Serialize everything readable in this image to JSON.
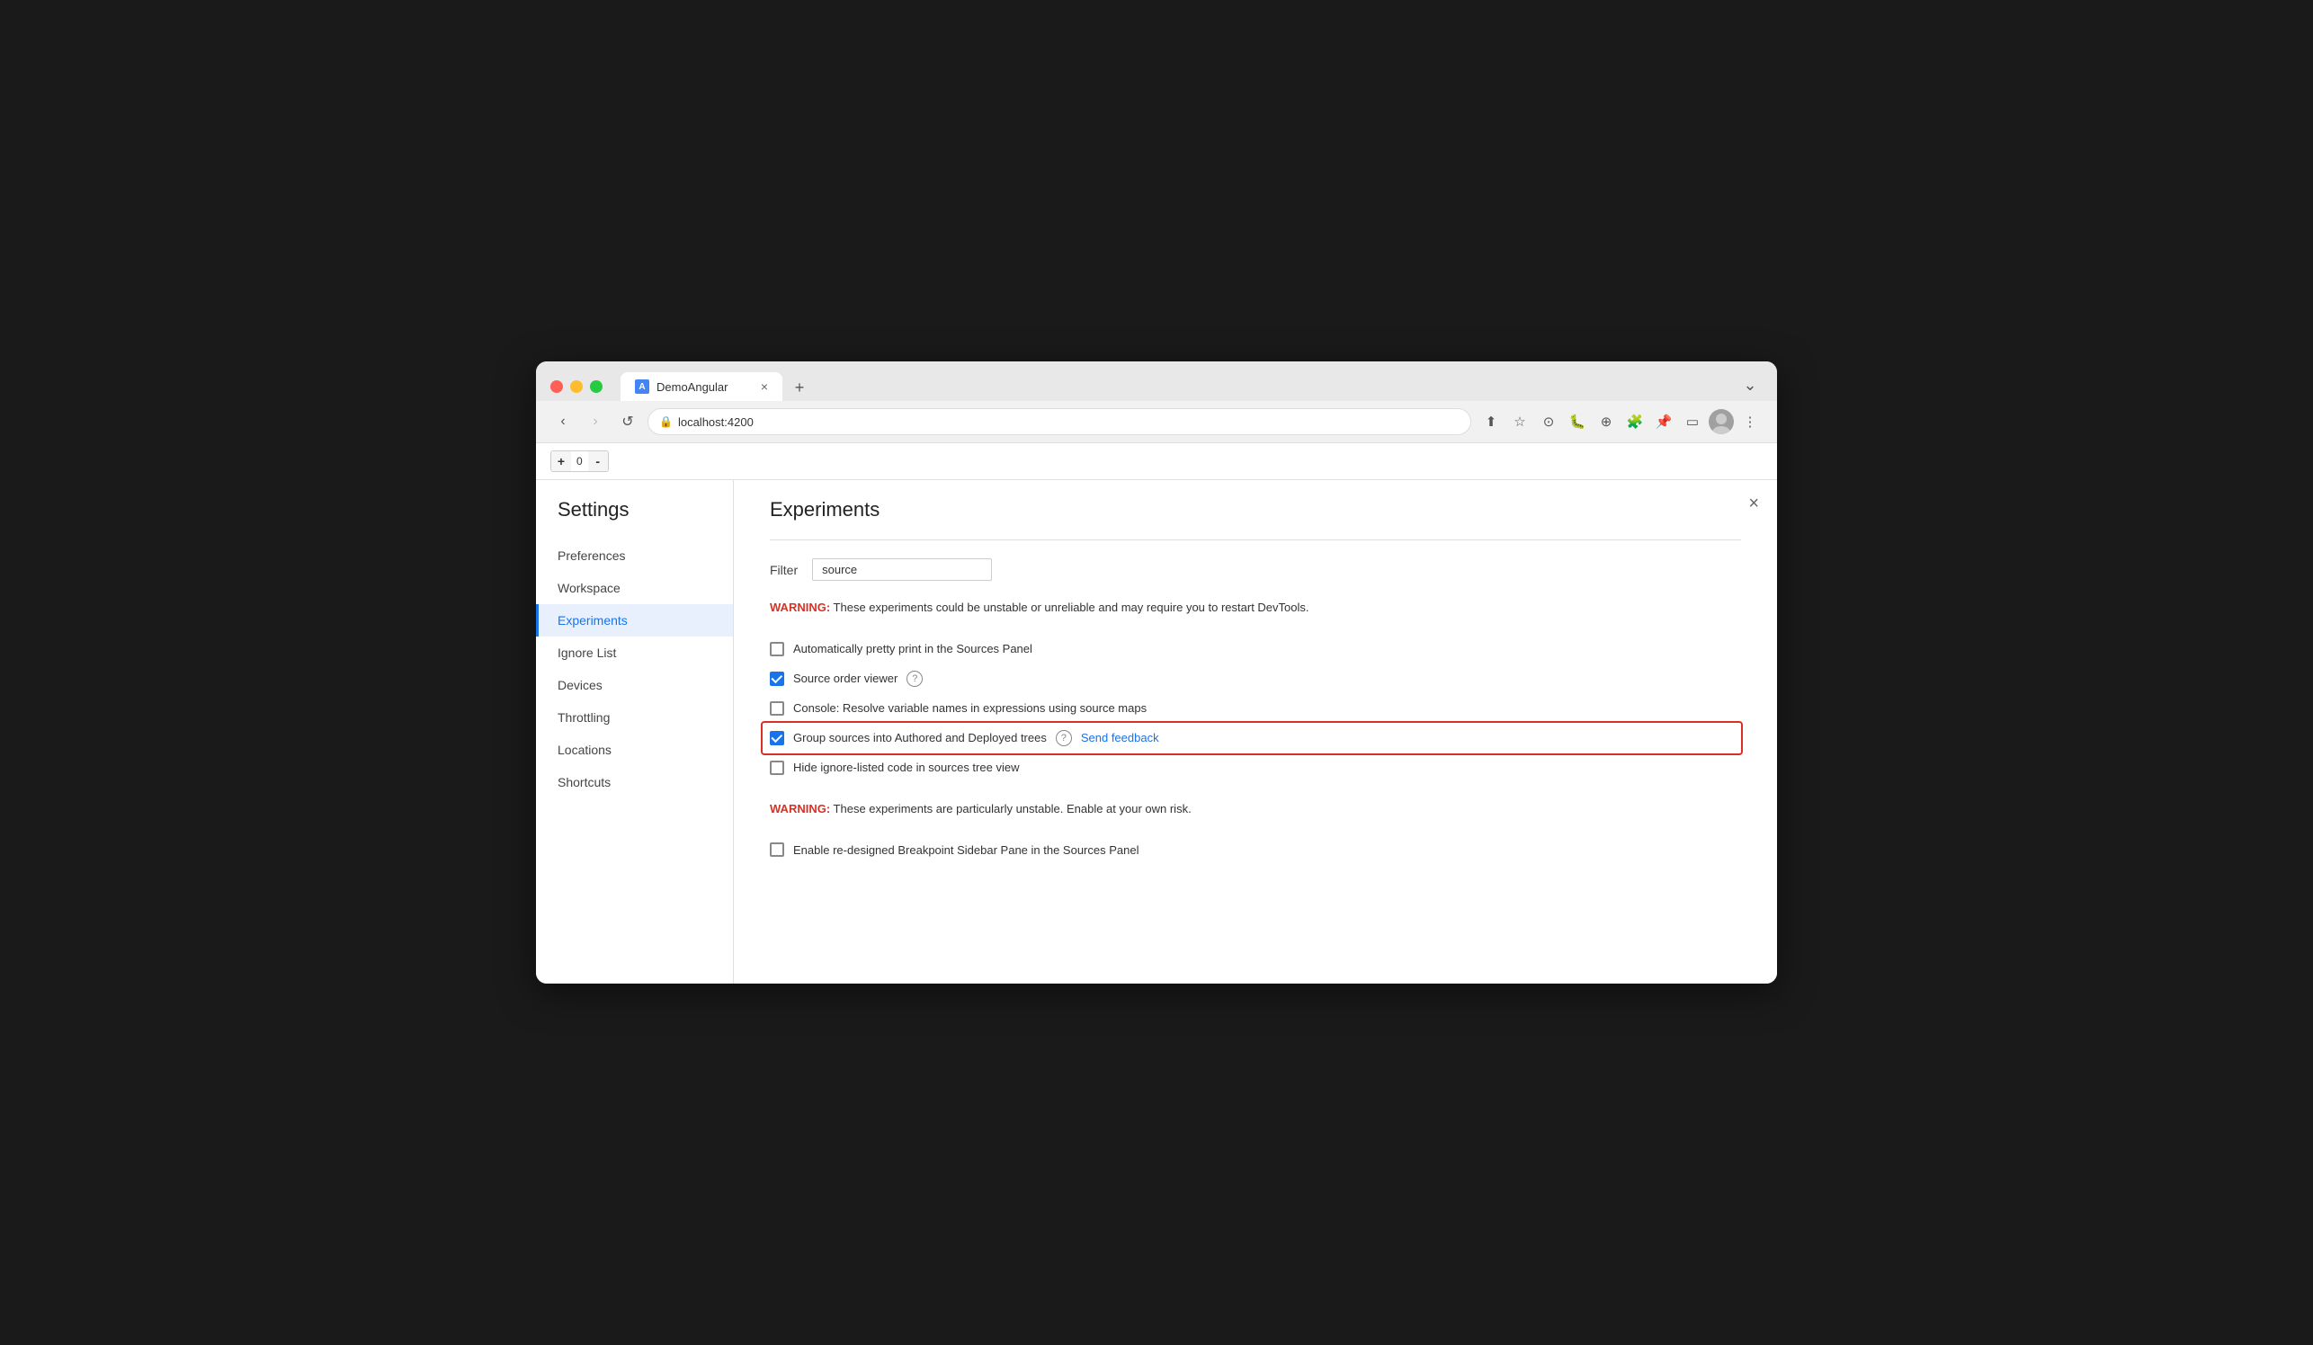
{
  "browser": {
    "tab_title": "DemoAngular",
    "tab_favicon": "A",
    "address": "localhost:4200",
    "new_tab_label": "+",
    "close_tab_label": "×",
    "nav": {
      "back": "‹",
      "forward": "›",
      "refresh": "↺",
      "lock": "🔒"
    },
    "dropdown_icon": "⌄"
  },
  "counter_widget": {
    "minus": "-",
    "plus": "+",
    "value": "0"
  },
  "settings": {
    "title": "Settings",
    "close": "×",
    "sidebar_items": [
      {
        "id": "preferences",
        "label": "Preferences",
        "active": false
      },
      {
        "id": "workspace",
        "label": "Workspace",
        "active": false
      },
      {
        "id": "experiments",
        "label": "Experiments",
        "active": true
      },
      {
        "id": "ignore-list",
        "label": "Ignore List",
        "active": false
      },
      {
        "id": "devices",
        "label": "Devices",
        "active": false
      },
      {
        "id": "throttling",
        "label": "Throttling",
        "active": false
      },
      {
        "id": "locations",
        "label": "Locations",
        "active": false
      },
      {
        "id": "shortcuts",
        "label": "Shortcuts",
        "active": false
      }
    ]
  },
  "experiments": {
    "title": "Experiments",
    "filter_label": "Filter",
    "filter_value": "source",
    "filter_placeholder": "Filter",
    "warning1_prefix": "WARNING:",
    "warning1_text": " These experiments could be unstable or unreliable and may require you to restart DevTools.",
    "experiments": [
      {
        "id": "pretty-print",
        "checked": false,
        "label": "Automatically pretty print in the Sources Panel",
        "help": false,
        "feedback": false,
        "highlighted": false
      },
      {
        "id": "source-order-viewer",
        "checked": true,
        "label": "Source order viewer",
        "help": true,
        "feedback": false,
        "highlighted": false
      },
      {
        "id": "console-resolve",
        "checked": false,
        "label": "Console: Resolve variable names in expressions using source maps",
        "help": false,
        "feedback": false,
        "highlighted": false
      },
      {
        "id": "group-sources",
        "checked": true,
        "label": "Group sources into Authored and Deployed trees",
        "help": true,
        "feedback": true,
        "feedback_text": "Send feedback",
        "highlighted": true
      },
      {
        "id": "hide-ignore",
        "checked": false,
        "label": "Hide ignore-listed code in sources tree view",
        "help": false,
        "feedback": false,
        "highlighted": false
      }
    ],
    "warning2_prefix": "WARNING:",
    "warning2_text": " These experiments are particularly unstable. Enable at your own risk.",
    "unstable_experiments": [
      {
        "id": "breakpoint-sidebar",
        "checked": false,
        "label": "Enable re-designed Breakpoint Sidebar Pane in the Sources Panel"
      }
    ]
  }
}
